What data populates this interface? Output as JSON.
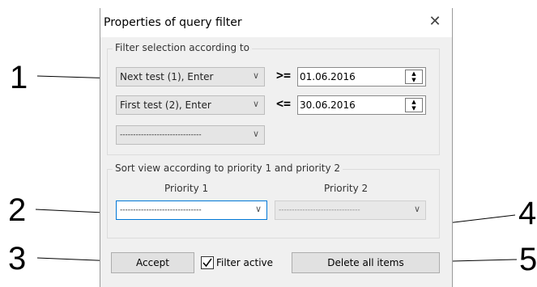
{
  "dialog": {
    "title": "Properties of query filter",
    "close_icon": "close-icon"
  },
  "filter_group": {
    "title": "Filter selection according to",
    "rows": [
      {
        "field": "Next test (1), Enter",
        "operator": ">=",
        "date": "01.06.2016"
      },
      {
        "field": "First test (2), Enter",
        "operator": "<=",
        "date": "30.06.2016"
      }
    ],
    "third_field": "-------------------------------"
  },
  "sort_group": {
    "title": "Sort view according to priority 1 and priority 2",
    "priority1_label": "Priority 1",
    "priority2_label": "Priority 2",
    "priority1_value": "-------------------------------",
    "priority2_value": "-------------------------------"
  },
  "footer": {
    "accept_label": "Accept",
    "filter_active_label": "Filter active",
    "filter_active_checked": true,
    "delete_all_label": "Delete all items"
  },
  "callouts": [
    "1",
    "2",
    "3",
    "4",
    "5"
  ]
}
